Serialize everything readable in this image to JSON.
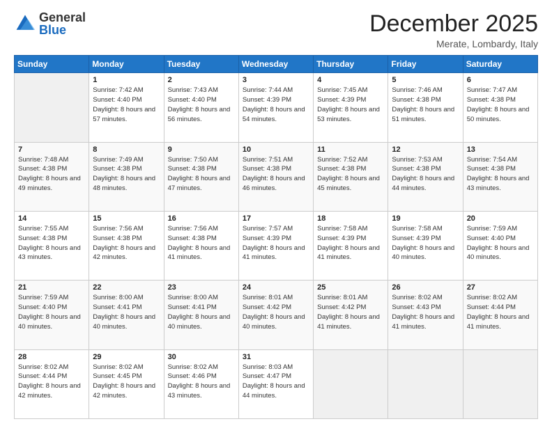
{
  "header": {
    "logo_general": "General",
    "logo_blue": "Blue",
    "month": "December 2025",
    "location": "Merate, Lombardy, Italy"
  },
  "days_of_week": [
    "Sunday",
    "Monday",
    "Tuesday",
    "Wednesday",
    "Thursday",
    "Friday",
    "Saturday"
  ],
  "weeks": [
    [
      {
        "num": "",
        "empty": true
      },
      {
        "num": "1",
        "sunrise": "7:42 AM",
        "sunset": "4:40 PM",
        "daylight": "8 hours and 57 minutes."
      },
      {
        "num": "2",
        "sunrise": "7:43 AM",
        "sunset": "4:40 PM",
        "daylight": "8 hours and 56 minutes."
      },
      {
        "num": "3",
        "sunrise": "7:44 AM",
        "sunset": "4:39 PM",
        "daylight": "8 hours and 54 minutes."
      },
      {
        "num": "4",
        "sunrise": "7:45 AM",
        "sunset": "4:39 PM",
        "daylight": "8 hours and 53 minutes."
      },
      {
        "num": "5",
        "sunrise": "7:46 AM",
        "sunset": "4:38 PM",
        "daylight": "8 hours and 51 minutes."
      },
      {
        "num": "6",
        "sunrise": "7:47 AM",
        "sunset": "4:38 PM",
        "daylight": "8 hours and 50 minutes."
      }
    ],
    [
      {
        "num": "7",
        "sunrise": "7:48 AM",
        "sunset": "4:38 PM",
        "daylight": "8 hours and 49 minutes."
      },
      {
        "num": "8",
        "sunrise": "7:49 AM",
        "sunset": "4:38 PM",
        "daylight": "8 hours and 48 minutes."
      },
      {
        "num": "9",
        "sunrise": "7:50 AM",
        "sunset": "4:38 PM",
        "daylight": "8 hours and 47 minutes."
      },
      {
        "num": "10",
        "sunrise": "7:51 AM",
        "sunset": "4:38 PM",
        "daylight": "8 hours and 46 minutes."
      },
      {
        "num": "11",
        "sunrise": "7:52 AM",
        "sunset": "4:38 PM",
        "daylight": "8 hours and 45 minutes."
      },
      {
        "num": "12",
        "sunrise": "7:53 AM",
        "sunset": "4:38 PM",
        "daylight": "8 hours and 44 minutes."
      },
      {
        "num": "13",
        "sunrise": "7:54 AM",
        "sunset": "4:38 PM",
        "daylight": "8 hours and 43 minutes."
      }
    ],
    [
      {
        "num": "14",
        "sunrise": "7:55 AM",
        "sunset": "4:38 PM",
        "daylight": "8 hours and 43 minutes."
      },
      {
        "num": "15",
        "sunrise": "7:56 AM",
        "sunset": "4:38 PM",
        "daylight": "8 hours and 42 minutes."
      },
      {
        "num": "16",
        "sunrise": "7:56 AM",
        "sunset": "4:38 PM",
        "daylight": "8 hours and 41 minutes."
      },
      {
        "num": "17",
        "sunrise": "7:57 AM",
        "sunset": "4:39 PM",
        "daylight": "8 hours and 41 minutes."
      },
      {
        "num": "18",
        "sunrise": "7:58 AM",
        "sunset": "4:39 PM",
        "daylight": "8 hours and 41 minutes."
      },
      {
        "num": "19",
        "sunrise": "7:58 AM",
        "sunset": "4:39 PM",
        "daylight": "8 hours and 40 minutes."
      },
      {
        "num": "20",
        "sunrise": "7:59 AM",
        "sunset": "4:40 PM",
        "daylight": "8 hours and 40 minutes."
      }
    ],
    [
      {
        "num": "21",
        "sunrise": "7:59 AM",
        "sunset": "4:40 PM",
        "daylight": "8 hours and 40 minutes."
      },
      {
        "num": "22",
        "sunrise": "8:00 AM",
        "sunset": "4:41 PM",
        "daylight": "8 hours and 40 minutes."
      },
      {
        "num": "23",
        "sunrise": "8:00 AM",
        "sunset": "4:41 PM",
        "daylight": "8 hours and 40 minutes."
      },
      {
        "num": "24",
        "sunrise": "8:01 AM",
        "sunset": "4:42 PM",
        "daylight": "8 hours and 40 minutes."
      },
      {
        "num": "25",
        "sunrise": "8:01 AM",
        "sunset": "4:42 PM",
        "daylight": "8 hours and 41 minutes."
      },
      {
        "num": "26",
        "sunrise": "8:02 AM",
        "sunset": "4:43 PM",
        "daylight": "8 hours and 41 minutes."
      },
      {
        "num": "27",
        "sunrise": "8:02 AM",
        "sunset": "4:44 PM",
        "daylight": "8 hours and 41 minutes."
      }
    ],
    [
      {
        "num": "28",
        "sunrise": "8:02 AM",
        "sunset": "4:44 PM",
        "daylight": "8 hours and 42 minutes."
      },
      {
        "num": "29",
        "sunrise": "8:02 AM",
        "sunset": "4:45 PM",
        "daylight": "8 hours and 42 minutes."
      },
      {
        "num": "30",
        "sunrise": "8:02 AM",
        "sunset": "4:46 PM",
        "daylight": "8 hours and 43 minutes."
      },
      {
        "num": "31",
        "sunrise": "8:03 AM",
        "sunset": "4:47 PM",
        "daylight": "8 hours and 44 minutes."
      },
      {
        "num": "",
        "empty": true
      },
      {
        "num": "",
        "empty": true
      },
      {
        "num": "",
        "empty": true
      }
    ]
  ]
}
